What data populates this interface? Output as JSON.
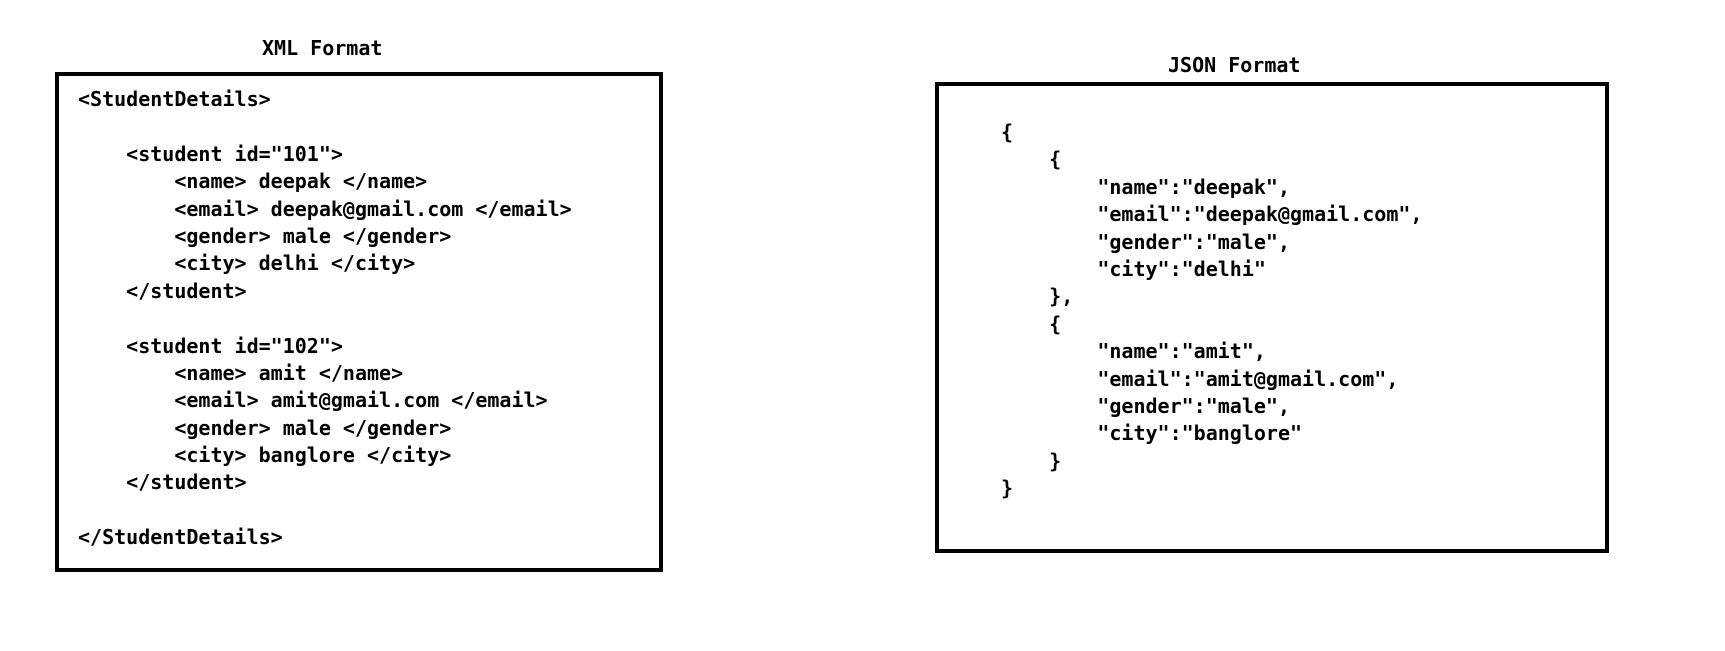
{
  "xml_panel": {
    "title": "XML Format",
    "lines": [
      "<StudentDetails>",
      "",
      "    <student id=\"101\">",
      "        <name> deepak </name>",
      "        <email> deepak@gmail.com </email>",
      "        <gender> male </gender>",
      "        <city> delhi </city>",
      "    </student>",
      "",
      "    <student id=\"102\">",
      "        <name> amit </name>",
      "        <email> amit@gmail.com </email>",
      "        <gender> male </gender>",
      "        <city> banglore </city>",
      "    </student>",
      "",
      "</StudentDetails>"
    ]
  },
  "json_panel": {
    "title": "JSON Format",
    "lines": [
      "{",
      "    {",
      "        \"name\":\"deepak\",",
      "        \"email\":\"deepak@gmail.com\",",
      "        \"gender\":\"male\",",
      "        \"city\":\"delhi\"",
      "    },",
      "    {",
      "        \"name\":\"amit\",",
      "        \"email\":\"amit@gmail.com\",",
      "        \"gender\":\"male\",",
      "        \"city\":\"banglore\"",
      "    }",
      "}"
    ]
  }
}
